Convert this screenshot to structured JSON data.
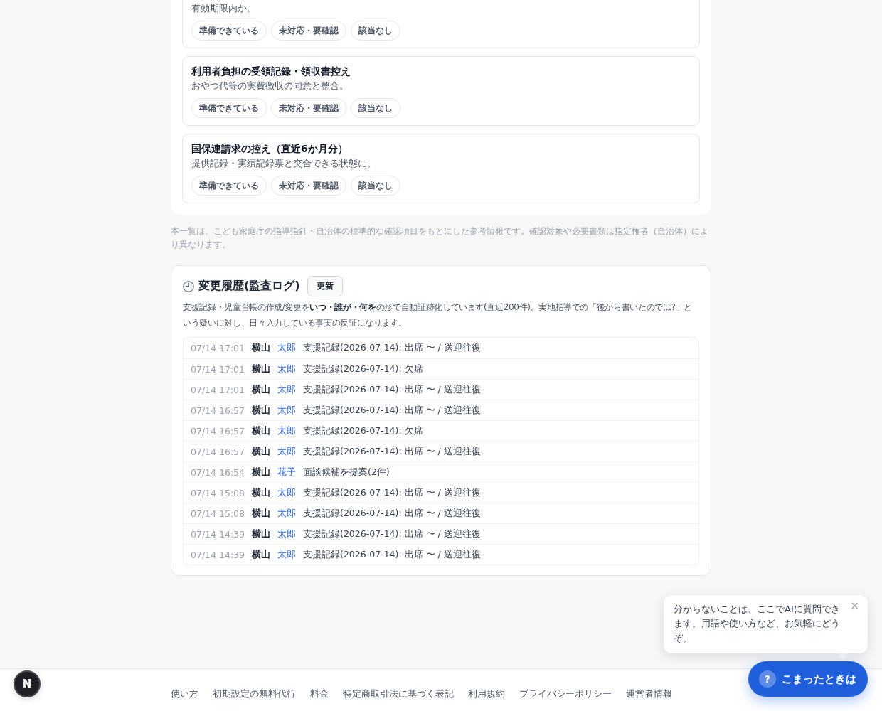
{
  "checklist": {
    "items": [
      {
        "description": "有効期限内か。",
        "options": [
          {
            "label": "準備できている",
            "selected": false
          },
          {
            "label": "未対応・要確認",
            "selected": false
          },
          {
            "label": "該当なし",
            "selected": false
          }
        ]
      },
      {
        "title": "利用者負担の受領記録・領収書控え",
        "description": "おやつ代等の実費徴収の同意と整合。",
        "options": [
          {
            "label": "準備できている",
            "selected": false
          },
          {
            "label": "未対応・要確認",
            "selected": false
          },
          {
            "label": "該当なし",
            "selected": false
          }
        ]
      },
      {
        "title": "国保連請求の控え（直近6か月分）",
        "description": "提供記録・実績記録票と突合できる状態に。",
        "options": [
          {
            "label": "準備できている",
            "selected": false
          },
          {
            "label": "未対応・要確認",
            "selected": false
          },
          {
            "label": "該当なし",
            "selected": false
          }
        ]
      }
    ],
    "note": "本一覧は、こども家庭庁の指導指針・自治体の標準的な確認項目をもとにした参考情報です。確認対象や必要書類は指定権者（自治体）により異なります。"
  },
  "audit_log": {
    "title": "変更履歴(監査ログ)",
    "refresh_button": "更新",
    "description": "支援記録・児童台帳の作成/変更を**いつ・誰が・何を**の形で自動証跡化しています(直近200件)。実地指導での「後から書いたのでは?」という疑いに対し、日々入力している事実の反証になります。",
    "rows": [
      {
        "time": "07/14 17:01",
        "actor": "横山",
        "child": "太郎",
        "action": "支援記録(2026-07-14): 出席 〜 / 送迎往復"
      },
      {
        "time": "07/14 17:01",
        "actor": "横山",
        "child": "太郎",
        "action": "支援記録(2026-07-14): 欠席"
      },
      {
        "time": "07/14 17:01",
        "actor": "横山",
        "child": "太郎",
        "action": "支援記録(2026-07-14): 出席 〜 / 送迎往復"
      },
      {
        "time": "07/14 16:57",
        "actor": "横山",
        "child": "太郎",
        "action": "支援記録(2026-07-14): 出席 〜 / 送迎往復"
      },
      {
        "time": "07/14 16:57",
        "actor": "横山",
        "child": "太郎",
        "action": "支援記録(2026-07-14): 欠席"
      },
      {
        "time": "07/14 16:57",
        "actor": "横山",
        "child": "太郎",
        "action": "支援記録(2026-07-14): 出席 〜 / 送迎往復"
      },
      {
        "time": "07/14 16:54",
        "actor": "横山",
        "child": "花子",
        "action": "面談候補を提案(2件)"
      },
      {
        "time": "07/14 15:08",
        "actor": "横山",
        "child": "太郎",
        "action": "支援記録(2026-07-14): 出席 〜 / 送迎往復"
      },
      {
        "time": "07/14 15:08",
        "actor": "横山",
        "child": "太郎",
        "action": "支援記録(2026-07-14): 出席 〜 / 送迎往復"
      },
      {
        "time": "07/14 14:39",
        "actor": "横山",
        "child": "太郎",
        "action": "支援記録(2026-07-14): 出席 〜 / 送迎往復"
      },
      {
        "time": "07/14 14:39",
        "actor": "横山",
        "child": "太郎",
        "action": "支援記録(2026-07-14): 出席 〜 / 送迎往復"
      }
    ]
  },
  "footer": {
    "links": [
      "使い方",
      "初期設定の無料代行",
      "料金",
      "特定商取引法に基づく表記",
      "利用規約",
      "プライバシーポリシー",
      "運営者情報"
    ]
  },
  "dev_badge": {
    "label": "N"
  },
  "help": {
    "message": "分からないことは、ここでAIに質問できます。用語や使い方など、お気軽にどうぞ。",
    "close": "×",
    "icon": "?",
    "button": "こまったときは"
  }
}
